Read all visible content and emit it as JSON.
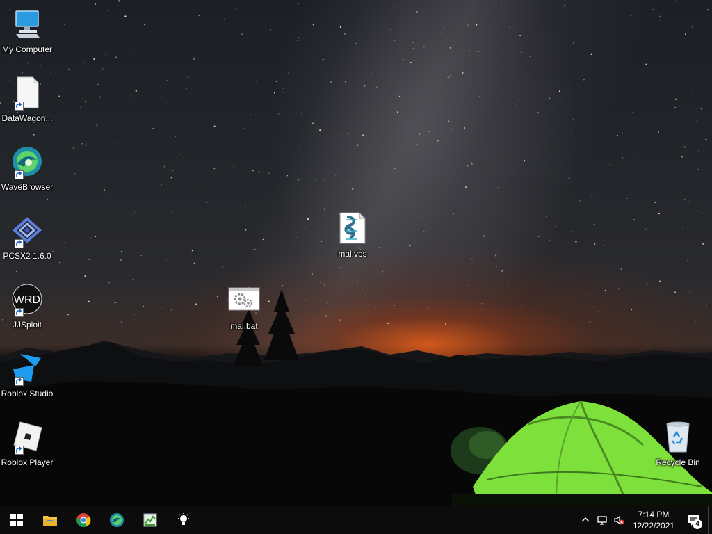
{
  "desktop": {
    "icons": [
      {
        "label": "My Computer",
        "icon": "computer-icon",
        "shortcut": false
      },
      {
        "label": "DataWagon...",
        "icon": "blank-file-icon",
        "shortcut": true
      },
      {
        "label": "WaveBrowser",
        "icon": "wavebrowser-icon",
        "shortcut": true
      },
      {
        "label": "PCSX2 1.6.0",
        "icon": "pcsx2-icon",
        "shortcut": true
      },
      {
        "label": "JJSploit",
        "icon": "jjsploit-icon",
        "shortcut": true
      },
      {
        "label": "Roblox Studio",
        "icon": "roblox-studio-icon",
        "shortcut": true
      },
      {
        "label": "Roblox Player",
        "icon": "roblox-player-icon",
        "shortcut": true
      },
      {
        "label": "mal.vbs",
        "icon": "vbs-script-icon",
        "shortcut": false
      },
      {
        "label": "mal.bat",
        "icon": "batch-file-icon",
        "shortcut": false
      },
      {
        "label": "Recycle Bin",
        "icon": "recycle-bin-icon",
        "shortcut": false
      }
    ]
  },
  "taskbar": {
    "pinned": [
      {
        "name": "file-explorer-icon",
        "active": false
      },
      {
        "name": "chrome-icon",
        "active": false
      },
      {
        "name": "edge-icon",
        "active": false
      },
      {
        "name": "task-manager-icon",
        "active": true
      },
      {
        "name": "tips-icon",
        "active": true
      }
    ],
    "clock": {
      "time": "7:14 PM",
      "date": "12/22/2021"
    },
    "notification_count": "4"
  },
  "colors": {
    "taskbar": "#0c0c0d",
    "taskbar_active_indicator": "#7fb2e0",
    "tent": "#7ee03a",
    "glow": "#e65f19"
  }
}
